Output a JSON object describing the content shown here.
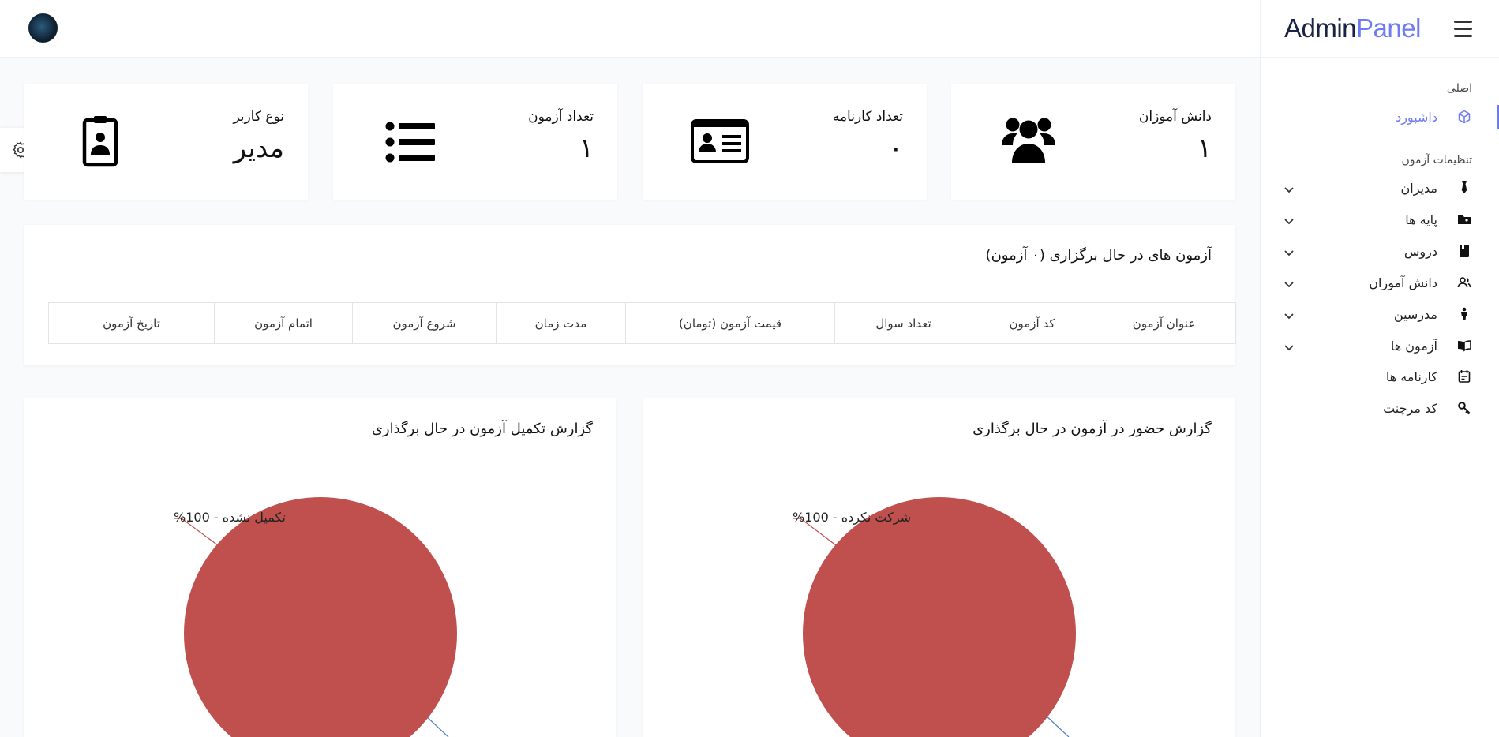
{
  "brand": {
    "admin": "Admin",
    "panel": "Panel"
  },
  "sidebar": {
    "section_main": "اصلی",
    "section_exam": "تنظیمات آزمون",
    "items": [
      {
        "label": "داشبورد",
        "icon": "cube-icon",
        "active": true
      },
      {
        "label": "مدیران",
        "icon": "tie-icon"
      },
      {
        "label": "پایه ها",
        "icon": "folder-icon"
      },
      {
        "label": "دروس",
        "icon": "book-icon"
      },
      {
        "label": "دانش آموزان",
        "icon": "users-icon"
      },
      {
        "label": "مدرسین",
        "icon": "person-icon"
      },
      {
        "label": "آزمون ها",
        "icon": "book-open-icon"
      },
      {
        "label": "کارنامه ها",
        "icon": "calendar-icon"
      },
      {
        "label": "کد مرچنت",
        "icon": "key-icon"
      }
    ]
  },
  "stats": [
    {
      "title": "دانش آموزان",
      "value": "۱",
      "icon": "users-icon"
    },
    {
      "title": "تعداد کارنامه",
      "value": "۰",
      "icon": "id-card-icon"
    },
    {
      "title": "تعداد آزمون",
      "value": "۱",
      "icon": "list-icon"
    },
    {
      "title": "نوع کاربر",
      "value": "مدیر",
      "icon": "badge-icon"
    }
  ],
  "ongoing": {
    "title": "آزمون های در حال برگزاری (۰ آزمون)",
    "columns": [
      "عنوان آزمون",
      "کد آزمون",
      "تعداد سوال",
      "قیمت آزمون (تومان)",
      "مدت زمان",
      "شروع آزمون",
      "اتمام آزمون",
      "تاریخ آزمون"
    ]
  },
  "attendance": {
    "title": "گزارش حضور در آزمون در حال برگذاری",
    "slice_label": "شرکت نکرده - 100%"
  },
  "completion": {
    "title": "گزارش تکمیل آزمون در حال برگذاری",
    "slice_label": "تکمیل نشده - 100%"
  },
  "chart_data": [
    {
      "type": "pie",
      "title": "گزارش حضور در آزمون در حال برگذاری",
      "categories": [
        "شرکت نکرده"
      ],
      "values": [
        100
      ],
      "colors": [
        "#c0504d"
      ]
    },
    {
      "type": "pie",
      "title": "گزارش تکمیل آزمون در حال برگذاری",
      "categories": [
        "تکمیل نشده"
      ],
      "values": [
        100
      ],
      "colors": [
        "#c0504d"
      ]
    }
  ],
  "colors": {
    "accent": "#6f7bf2",
    "pie": "#c0504d",
    "leader_main": "#c0504d",
    "leader_alt": "#4f81bd"
  }
}
